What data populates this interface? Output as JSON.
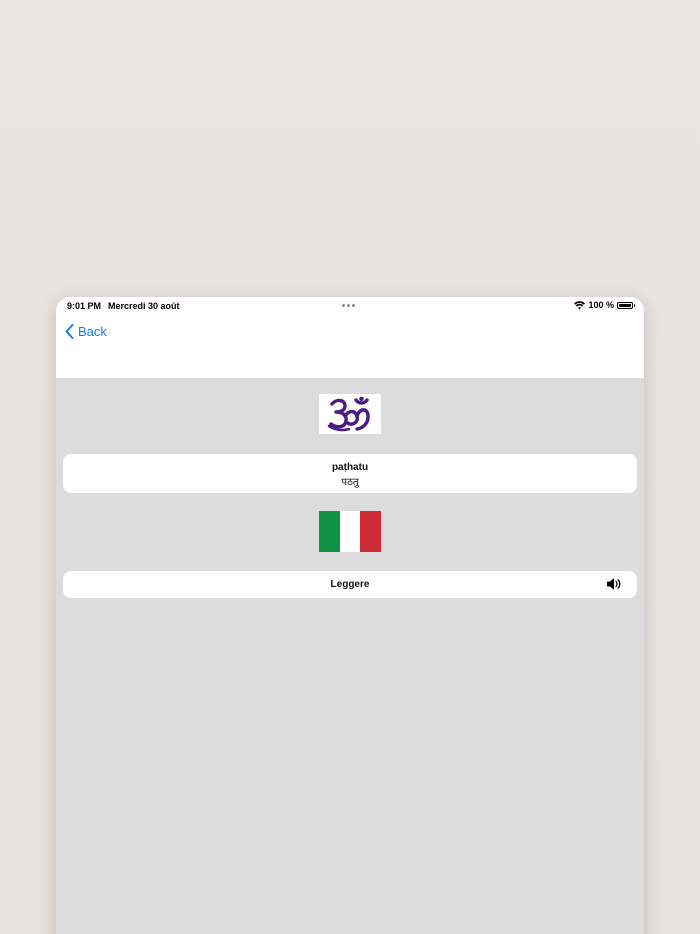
{
  "status_bar": {
    "time": "9:01 PM",
    "date": "Mercredi 30 août",
    "battery_text": "100 %",
    "battery_level": 1.0
  },
  "nav": {
    "back_label": "Back",
    "back_icon": "chevron-left-icon",
    "accent_color": "#1a7ce6"
  },
  "symbol": {
    "icon": "om-symbol-icon",
    "color": "#4b1a86"
  },
  "word": {
    "transliteration": "paṭhatu",
    "devanagari": "पठतु"
  },
  "flag": {
    "icon": "italy-flag-icon",
    "colors": [
      "#0f9246",
      "#ffffff",
      "#ce2b37"
    ]
  },
  "translation": {
    "text": "Leggere",
    "audio_icon": "speaker-icon"
  }
}
